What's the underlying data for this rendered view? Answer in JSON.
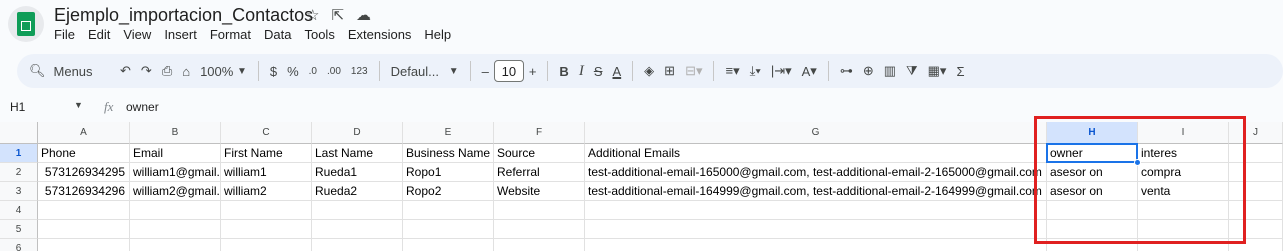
{
  "doc": {
    "title": "Ejemplo_importacion_Contactos",
    "menu": [
      "File",
      "Edit",
      "View",
      "Insert",
      "Format",
      "Data",
      "Tools",
      "Extensions",
      "Help"
    ]
  },
  "toolbar": {
    "search_label": "Menus",
    "zoom": "100%",
    "currency": "$",
    "percent": "%",
    "dec_decrease": ".0",
    "dec_increase": ".00",
    "number_format": "123",
    "font": "Defaul...",
    "font_size": "10",
    "minus": "–",
    "plus": "+",
    "bold": "B",
    "italic": "I",
    "strike": "S",
    "text_color": "A",
    "text_rotate": "A",
    "functions": "Σ"
  },
  "formula_bar": {
    "name_box": "H1",
    "fx": "fx",
    "content": "owner"
  },
  "grid": {
    "columns": [
      "A",
      "B",
      "C",
      "D",
      "E",
      "F",
      "G",
      "H",
      "I",
      "J"
    ],
    "rows": [
      "1",
      "2",
      "3",
      "4",
      "5",
      "6"
    ],
    "cells": [
      [
        "Phone",
        "Email",
        "First Name",
        "Last Name",
        "Business Name",
        "Source",
        "Additional Emails",
        "owner",
        "interes",
        ""
      ],
      [
        "573126934295",
        "william1@gmail.c",
        "william1",
        "Rueda1",
        "Ropo1",
        "Referral",
        "test-additional-email-165000@gmail.com, test-additional-email-2-165000@gmail.com",
        "asesor on",
        "compra",
        ""
      ],
      [
        "573126934296",
        "william2@gmail.c",
        "william2",
        "Rueda2",
        "Ropo2",
        "Website",
        "test-additional-email-164999@gmail.com, test-additional-email-2-164999@gmail.com",
        "asesor on",
        "venta",
        ""
      ]
    ],
    "selected_cell": "H1",
    "highlight_color": "#e02020"
  }
}
